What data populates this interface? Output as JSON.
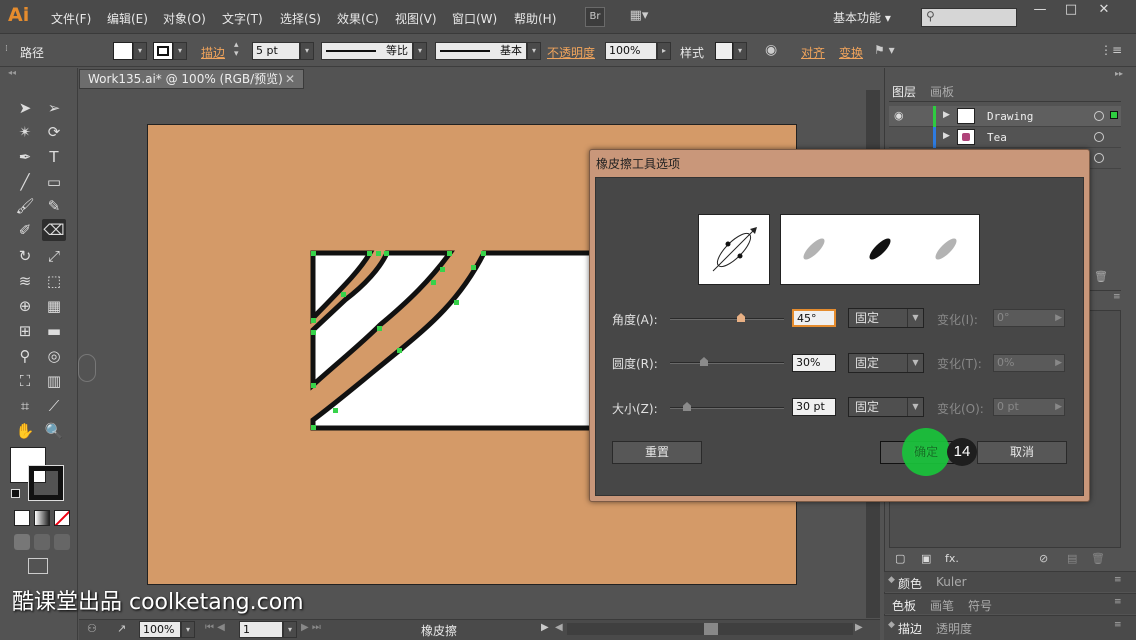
{
  "app": {
    "logo": "Ai",
    "menu": [
      "文件(F)",
      "编辑(E)",
      "对象(O)",
      "文字(T)",
      "选择(S)",
      "效果(C)",
      "视图(V)",
      "窗口(W)",
      "帮助(H)"
    ],
    "bridge_label": "Br",
    "workspace": "基本功能",
    "window_buttons": [
      "—",
      "□",
      "✕"
    ]
  },
  "control_bar": {
    "selection_type": "路径",
    "stroke_label": "描边",
    "stroke_value": "5 pt",
    "profile_label": "等比",
    "brush_label": "基本",
    "opacity_label": "不透明度",
    "opacity_value": "100%",
    "style_label": "样式",
    "align_label": "对齐",
    "transform_label": "变换"
  },
  "document": {
    "tab_title": "Work135.ai* @ 100% (RGB/预览)",
    "zoom": "100%",
    "artboard_number": "1",
    "current_tool": "橡皮擦",
    "artboard_color": "#d49a68"
  },
  "layers_panel": {
    "tabs": [
      "图层",
      "画板"
    ],
    "layers": [
      {
        "name": "Drawing",
        "color": "#2ecc40",
        "thumb": "drawing"
      },
      {
        "name": "Tea",
        "color": "#2e7be0",
        "thumb": "tea"
      }
    ]
  },
  "bottom_panels": {
    "color_tabs": [
      "颜色",
      "Kuler"
    ],
    "swatch_tabs": [
      "色板",
      "画笔",
      "符号"
    ],
    "stroke_tabs": [
      "描边",
      "透明度"
    ]
  },
  "dialog": {
    "title": "橡皮擦工具选项",
    "rows": [
      {
        "label": "角度(A):",
        "value": "45°",
        "mode": "固定",
        "variation_label": "变化(I):",
        "variation_value": "0°",
        "slider_fraction": 0.62
      },
      {
        "label": "圆度(R):",
        "value": "30%",
        "mode": "固定",
        "variation_label": "变化(T):",
        "variation_value": "0%",
        "slider_fraction": 0.3
      },
      {
        "label": "大小(Z):",
        "value": "30 pt",
        "mode": "固定",
        "variation_label": "变化(O):",
        "variation_value": "0 pt",
        "slider_fraction": 0.15
      }
    ],
    "reset_label": "重置",
    "ok_label": "确定",
    "cancel_label": "取消"
  },
  "overlay": {
    "step_number": "14",
    "highlight_color": "#19c43b"
  },
  "watermark": "酷课堂出品 coolketang.com"
}
